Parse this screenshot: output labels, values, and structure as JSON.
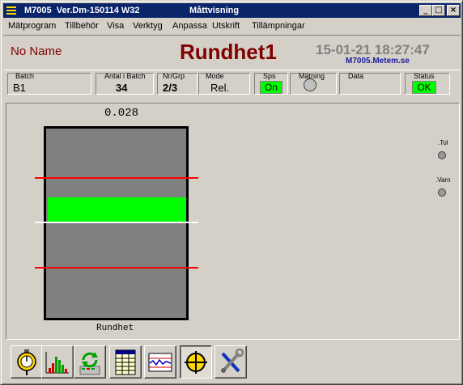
{
  "window": {
    "app_name": "M7005",
    "version": "Ver.Dm-150114 W32",
    "view_name": "Måttvisning",
    "controls": [
      "_",
      "□",
      "×"
    ]
  },
  "menu": [
    "Mätprogram",
    "Tillbehör",
    "Visa",
    "Verktyg",
    "Anpassa",
    "Utskrift",
    "Tillämpningar"
  ],
  "header": {
    "operator": "No Name",
    "title": "Rundhet1",
    "datetime": "15-01-21 18:27:47",
    "site": "M7005.Metem.se"
  },
  "fields": {
    "batch": {
      "label": "Batch",
      "value": "B1"
    },
    "count": {
      "label": "Antal i Batch",
      "value": "34"
    },
    "nrgrp": {
      "label": "Nr/Grp",
      "value": "2/3"
    },
    "mode": {
      "label": "Mode",
      "value": "Rel."
    },
    "sps": {
      "label": "Sps",
      "value": "On"
    },
    "matning": {
      "label": "Mätning"
    },
    "data": {
      "label": "Data",
      "value": ""
    },
    "status": {
      "label": "Status",
      "value": "OK"
    }
  },
  "measurement": {
    "reading": "0.028",
    "label": "Rundhet"
  },
  "indicators": [
    {
      "label": ".Tol",
      "state": "off"
    },
    {
      "label": ".Varn",
      "state": "off"
    }
  ],
  "toolbar": {
    "tools": [
      "dial-gauge-icon",
      "bar-chart-icon",
      "refresh-icon",
      "table-icon",
      "trend-chart-icon",
      "crosshair-icon",
      "tools-icon"
    ],
    "active": "crosshair-icon"
  },
  "colors": {
    "title_red": "#800000",
    "indicator_green": "#00ff00",
    "limit_red": "#ff0000"
  }
}
